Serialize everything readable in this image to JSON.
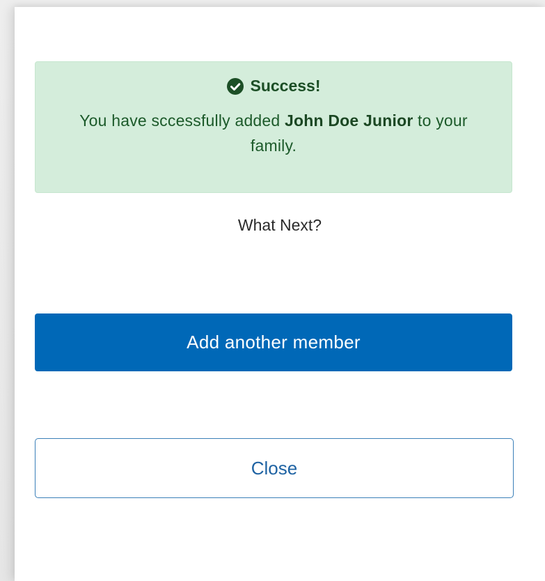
{
  "alert": {
    "icon": "check-circle-icon",
    "title": "Success!",
    "message_before": "You have sccessfully added ",
    "member_name": "John Doe Junior",
    "message_after": " to your family.",
    "colors": {
      "background": "#d4eddb",
      "text": "#1c5a2a"
    }
  },
  "prompt": {
    "text": "What Next?"
  },
  "actions": {
    "add_label": "Add another member",
    "close_label": "Close",
    "primary_color": "#0068b7"
  }
}
